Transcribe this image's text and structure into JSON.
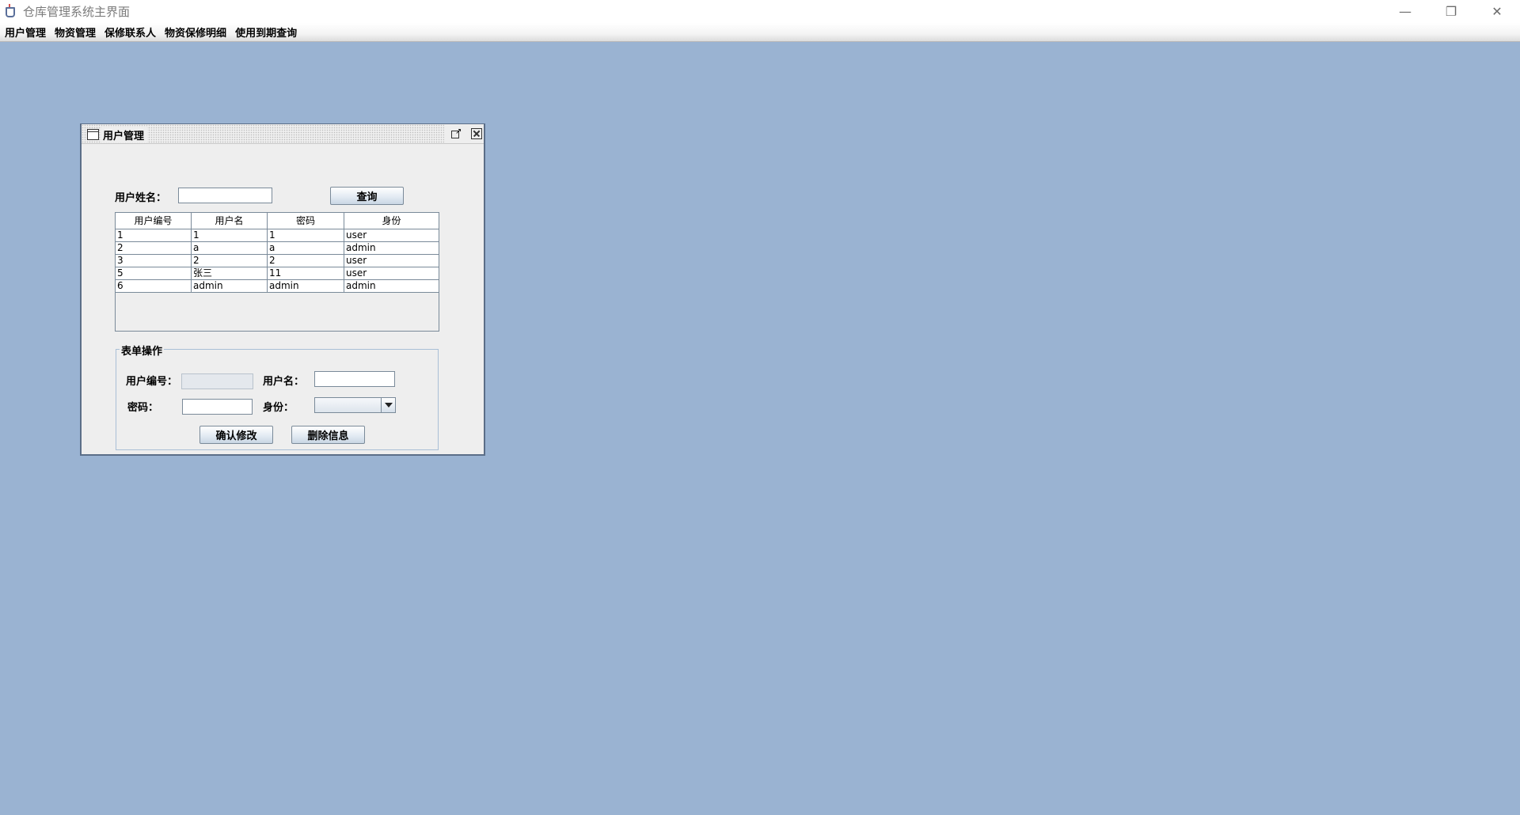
{
  "window": {
    "title": "仓库管理系统主界面",
    "controls": {
      "minimize": "—",
      "restore": "❐",
      "close": "✕"
    }
  },
  "menubar": [
    "用户管理",
    "物资管理",
    "保修联系人",
    "物资保修明细",
    "使用到期查询"
  ],
  "internal_frame": {
    "title": "用户管理",
    "search": {
      "label": "用户姓名：",
      "value": "",
      "button": "查询"
    },
    "table": {
      "columns": [
        "用户编号",
        "用户名",
        "密码",
        "身份"
      ],
      "rows": [
        [
          "1",
          "1",
          "1",
          "user"
        ],
        [
          "2",
          "a",
          "a",
          "admin"
        ],
        [
          "3",
          "2",
          "2",
          "user"
        ],
        [
          "5",
          "张三",
          "11",
          "user"
        ],
        [
          "6",
          "admin",
          "admin",
          "admin"
        ]
      ]
    },
    "form": {
      "title": "表单操作",
      "id_label": "用户编号：",
      "id_value": "",
      "name_label": "用户名：",
      "name_value": "",
      "password_label": "密码：",
      "password_value": "",
      "role_label": "身份：",
      "role_value": "",
      "confirm_button": "确认修改",
      "delete_button": "删除信息"
    }
  }
}
